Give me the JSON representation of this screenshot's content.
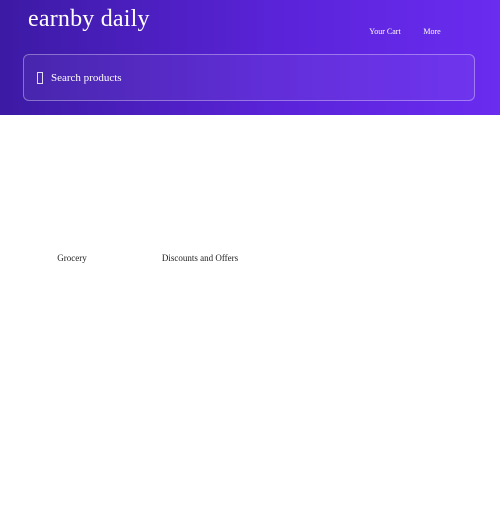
{
  "header": {
    "brand": "earnby daily",
    "nav": {
      "cart_label": "Your Cart",
      "more_label": "More"
    },
    "colors": {
      "gradient_start": "#3c1aa4",
      "gradient_end": "#6a2cf0"
    }
  },
  "search": {
    "placeholder": "Search products",
    "value": "",
    "icon": "search-icon"
  },
  "categories": [
    {
      "label": "Grocery"
    },
    {
      "label": "Discounts and Offers"
    }
  ]
}
